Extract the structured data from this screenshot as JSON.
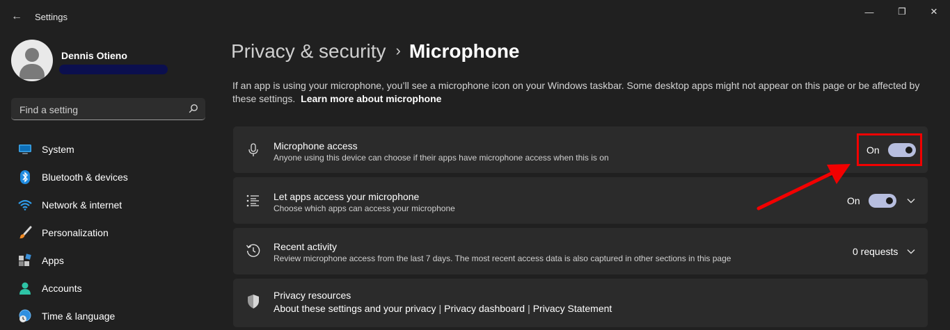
{
  "app": {
    "title": "Settings",
    "back_label": "←"
  },
  "window_controls": {
    "minimize": "—",
    "maximize": "❐",
    "close": "✕"
  },
  "profile": {
    "name": "Dennis Otieno"
  },
  "search": {
    "placeholder": "Find a setting"
  },
  "sidebar": {
    "items": [
      {
        "label": "System",
        "icon": "monitor-icon"
      },
      {
        "label": "Bluetooth & devices",
        "icon": "bluetooth-icon"
      },
      {
        "label": "Network & internet",
        "icon": "wifi-icon"
      },
      {
        "label": "Personalization",
        "icon": "brush-icon"
      },
      {
        "label": "Apps",
        "icon": "apps-icon"
      },
      {
        "label": "Accounts",
        "icon": "person-icon"
      },
      {
        "label": "Time & language",
        "icon": "globe-clock-icon"
      }
    ]
  },
  "header": {
    "parent": "Privacy & security",
    "separator": "›",
    "current": "Microphone"
  },
  "description": {
    "text": "If an app is using your microphone, you’ll see a microphone icon on your Windows taskbar. Some desktop apps might not appear on this page or be affected by these settings.",
    "link": "Learn more about microphone"
  },
  "cards": {
    "mic_access": {
      "title": "Microphone access",
      "subtitle": "Anyone using this device can choose if their apps have microphone access when this is on",
      "state": "On",
      "icon": "microphone-icon"
    },
    "apps_access": {
      "title": "Let apps access your microphone",
      "subtitle": "Choose which apps can access your microphone",
      "state": "On",
      "icon": "list-icon"
    },
    "recent": {
      "title": "Recent activity",
      "subtitle": "Review microphone access from the last 7 days. The most recent access data is also captured in other sections in this page",
      "value": "0 requests",
      "icon": "history-icon"
    },
    "privacy": {
      "title": "Privacy resources",
      "links": [
        "About these settings and your privacy",
        "Privacy dashboard",
        "Privacy Statement"
      ],
      "separator": "|",
      "icon": "shield-icon"
    }
  },
  "colors": {
    "background": "#202020",
    "card": "#2b2b2b",
    "toggle_on": "#b7bedf",
    "annotation": "#f20000"
  }
}
